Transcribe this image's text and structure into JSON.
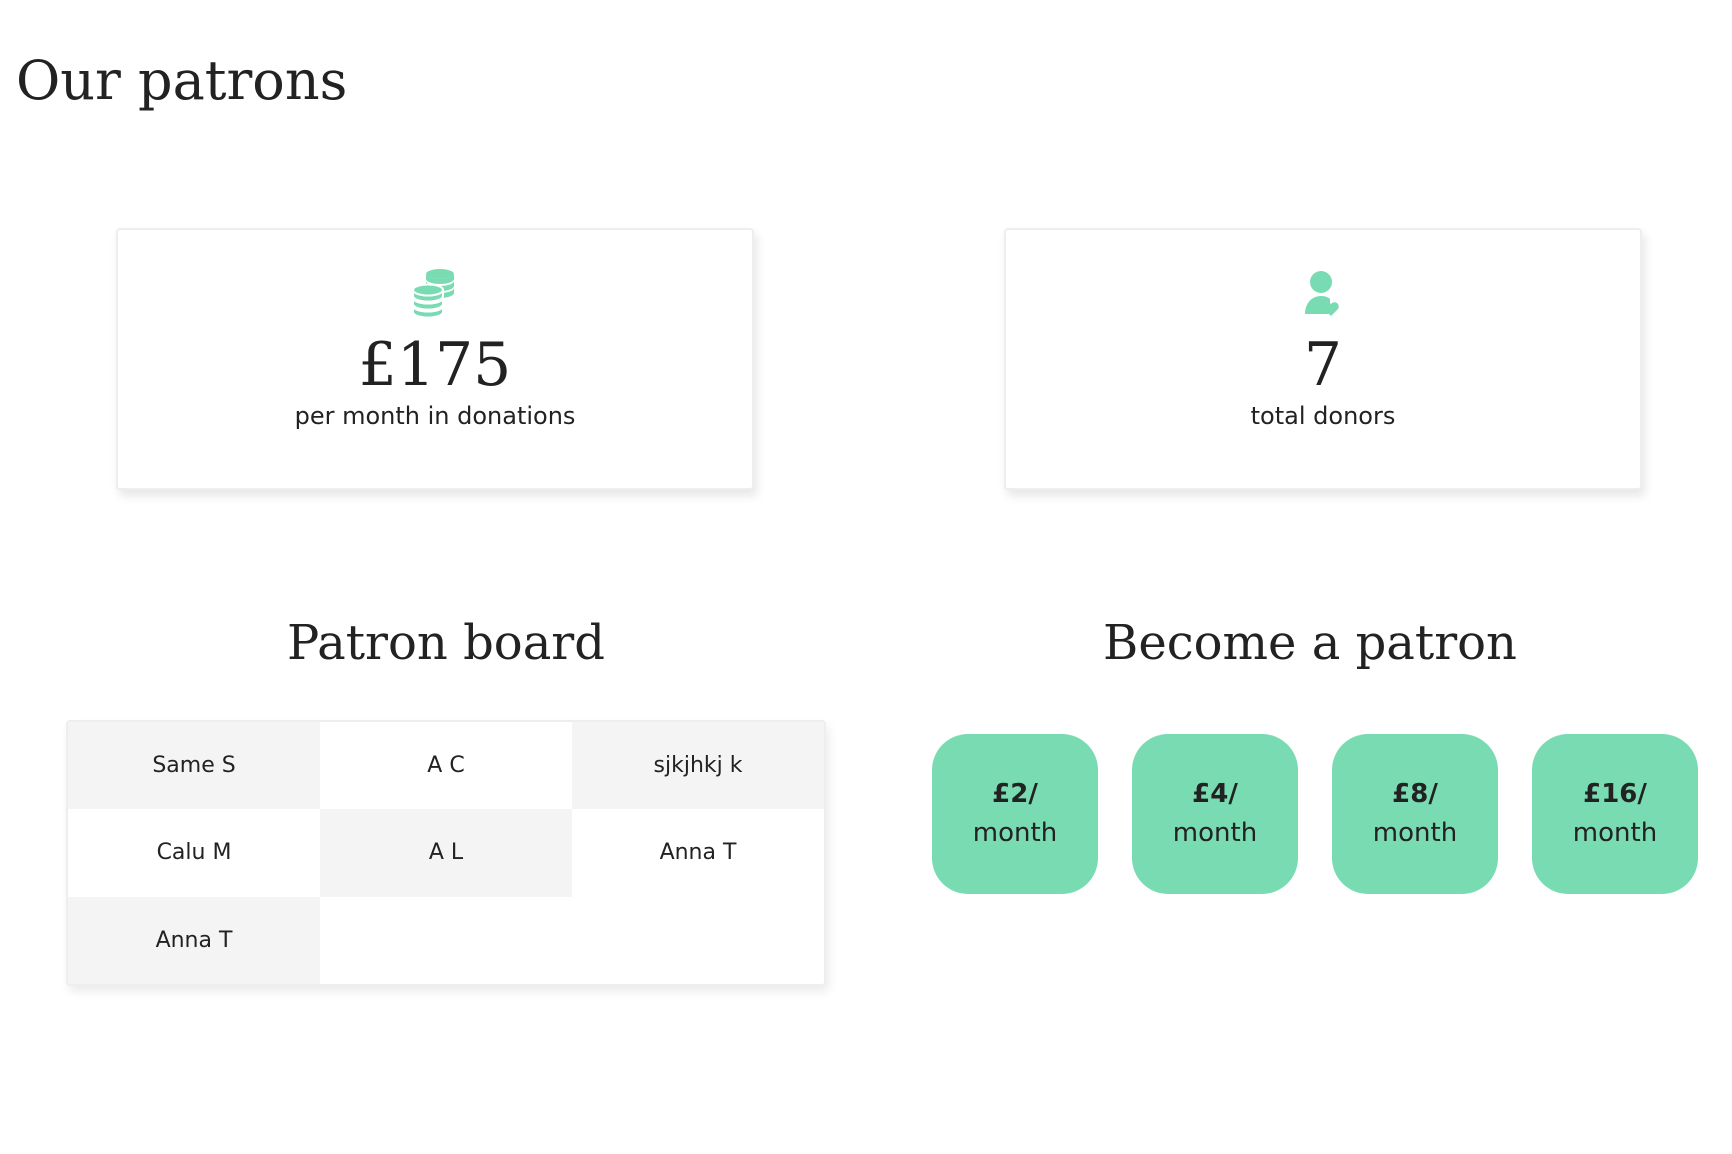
{
  "page": {
    "title": "Our patrons"
  },
  "stats": {
    "donations": {
      "icon": "coins-icon",
      "value": "£175",
      "label": "per month in donations"
    },
    "donors": {
      "icon": "user-heart-icon",
      "value": "7",
      "label": "total donors"
    }
  },
  "patron_board": {
    "heading": "Patron board",
    "patrons": [
      "Same S",
      "A C",
      "sjkjhkj k",
      "Calu M",
      "A L",
      "Anna T",
      "Anna T"
    ]
  },
  "become_patron": {
    "heading": "Become a patron",
    "tiers": [
      {
        "amount": "£2/",
        "period": "month"
      },
      {
        "amount": "£4/",
        "period": "month"
      },
      {
        "amount": "£8/",
        "period": "month"
      },
      {
        "amount": "£16/",
        "period": "month"
      }
    ]
  },
  "colors": {
    "accent": "#79dbb2",
    "text": "#222222",
    "cell_shade": "#f4f4f4"
  }
}
